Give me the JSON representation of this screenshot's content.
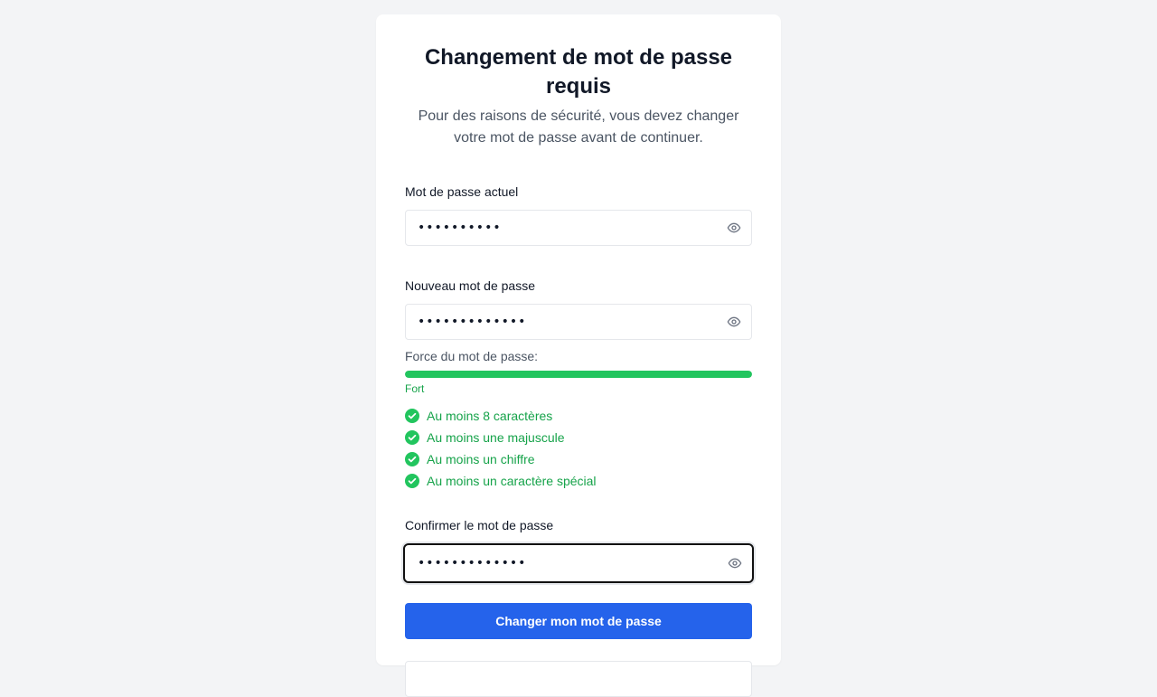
{
  "page": {
    "title": "Changement de mot de passe requis",
    "subtitle": "Pour des raisons de sécurité, vous devez changer votre mot de passe avant de continuer."
  },
  "fields": {
    "current": {
      "label": "Mot de passe actuel",
      "value": "••••••••••",
      "icon": "eye-icon"
    },
    "new": {
      "label": "Nouveau mot de passe",
      "value": "•••••••••••••",
      "icon": "eye-icon"
    },
    "confirm": {
      "label": "Confirmer le mot de passe",
      "value": "•••••••••••••",
      "icon": "eye-icon"
    }
  },
  "strength": {
    "label": "Force du mot de passe:",
    "value": "Fort",
    "level": 1.0,
    "color": "#22c55e"
  },
  "requirements": [
    {
      "text": "Au moins 8 caractères",
      "met": true
    },
    {
      "text": "Au moins une majuscule",
      "met": true
    },
    {
      "text": "Au moins un chiffre",
      "met": true
    },
    {
      "text": "Au moins un caractère spécial",
      "met": true
    }
  ],
  "submit": {
    "label": "Changer mon mot de passe"
  },
  "colors": {
    "accent": "#2563eb",
    "success": "#16a34a",
    "background": "#f3f4f6"
  }
}
